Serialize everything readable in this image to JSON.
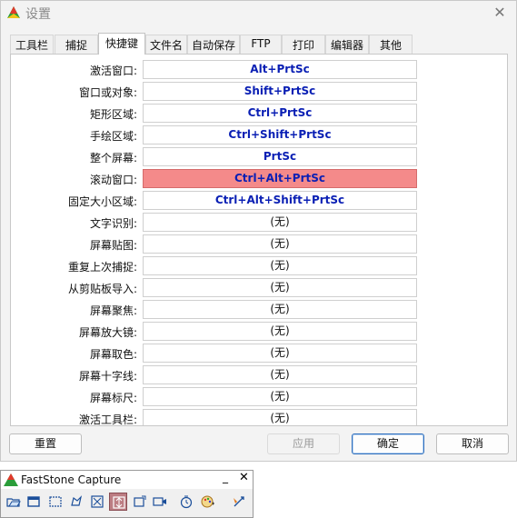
{
  "window": {
    "title": "设置",
    "close_glyph": "✕"
  },
  "tabs": [
    "工具栏",
    "捕捉",
    "快捷键",
    "文件名",
    "自动保存",
    "FTP",
    "打印",
    "编辑器",
    "其他"
  ],
  "active_tab": "快捷键",
  "shortcuts": [
    {
      "label": "激活窗口:",
      "value": "Alt+PrtSc",
      "kind": "key"
    },
    {
      "label": "窗口或对象:",
      "value": "Shift+PrtSc",
      "kind": "key"
    },
    {
      "label": "矩形区域:",
      "value": "Ctrl+PrtSc",
      "kind": "key"
    },
    {
      "label": "手绘区域:",
      "value": "Ctrl+Shift+PrtSc",
      "kind": "key"
    },
    {
      "label": "整个屏幕:",
      "value": "PrtSc",
      "kind": "key"
    },
    {
      "label": "滚动窗口:",
      "value": "Ctrl+Alt+PrtSc",
      "kind": "highlight"
    },
    {
      "label": "固定大小区域:",
      "value": "Ctrl+Alt+Shift+PrtSc",
      "kind": "key"
    },
    {
      "label": "文字识别:",
      "value": "(无)",
      "kind": "none"
    },
    {
      "label": "屏幕贴图:",
      "value": "(无)",
      "kind": "none"
    },
    {
      "label": "重复上次捕捉:",
      "value": "(无)",
      "kind": "none"
    },
    {
      "label": "从剪贴板导入:",
      "value": "(无)",
      "kind": "none"
    },
    {
      "label": "屏幕聚焦:",
      "value": "(无)",
      "kind": "none"
    },
    {
      "label": "屏幕放大镜:",
      "value": "(无)",
      "kind": "none"
    },
    {
      "label": "屏幕取色:",
      "value": "(无)",
      "kind": "none"
    },
    {
      "label": "屏幕十字线:",
      "value": "(无)",
      "kind": "none"
    },
    {
      "label": "屏幕标尺:",
      "value": "(无)",
      "kind": "none"
    },
    {
      "label": "激活工具栏:",
      "value": "(无)",
      "kind": "none"
    }
  ],
  "buttons": {
    "reset": "重置",
    "apply": "应用",
    "ok": "确定",
    "cancel": "取消"
  },
  "faststone": {
    "title": "FastStone Capture",
    "minimize_glyph": "_",
    "close_glyph": "✕",
    "tools": [
      "open-icon",
      "capture-window-icon",
      "capture-rectangle-icon",
      "capture-freehand-icon",
      "capture-fullscreen-icon",
      "capture-scrolling-icon",
      "capture-fixed-region-icon",
      "screen-recorder-icon",
      "delay-timer-icon",
      "output-palette-icon",
      "settings-icon"
    ],
    "selected_tool": "capture-scrolling-icon"
  },
  "colors": {
    "key_text": "#0a1fb4",
    "highlight_bg": "#f48a8a",
    "selected_tool_bg": "#bc7d83"
  }
}
